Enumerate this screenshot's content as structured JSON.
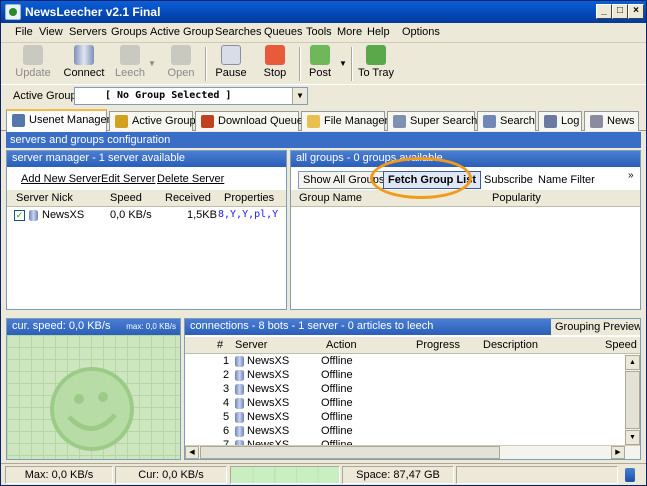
{
  "window": {
    "title": "NewsLeecher v2.1 Final"
  },
  "menu": [
    "File",
    "View",
    "Servers",
    "Groups",
    "Active Group",
    "Searches",
    "Queues",
    "Tools",
    "More",
    "Help",
    "Options"
  ],
  "toolbar": {
    "update": "Update",
    "connect": "Connect",
    "leech": "Leech",
    "open": "Open",
    "pause": "Pause",
    "stop": "Stop",
    "post": "Post",
    "to_tray": "To Tray"
  },
  "active_group": {
    "label": "Active Group",
    "value": "[ No Group Selected ]"
  },
  "tabs": [
    "Usenet Manager",
    "Active Group",
    "Download Queue",
    "File Manager",
    "Super Search",
    "Search",
    "Log",
    "News"
  ],
  "section_title": "servers and groups configuration",
  "server_manager": {
    "header": "server manager - 1 server available",
    "actions": [
      "Add New Server",
      "Edit Server",
      "Delete Server"
    ],
    "columns": [
      "Server Nick",
      "Speed",
      "Received",
      "Properties"
    ],
    "rows": [
      {
        "nick": "NewsXS",
        "speed": "0,0 KB/s",
        "received": "1,5KB",
        "properties": "8,Y,Y,pl,Y"
      }
    ]
  },
  "groups": {
    "header": "all groups - 0 groups available",
    "show_all": "Show All Groups",
    "fetch": "Fetch Group List",
    "subscribe": "Subscribe",
    "filter": "Name Filter",
    "more": "»",
    "columns": [
      "Group Name",
      "Popularity"
    ]
  },
  "speed": {
    "header": "cur. speed: 0,0 KB/s",
    "max": "max: 0,0 KB/s"
  },
  "connections": {
    "header": "connections - 8 bots - 1 server - 0 articles to leech",
    "grouping": "Grouping",
    "preview": "Preview",
    "columns": [
      "#",
      "Server",
      "Action",
      "Progress",
      "Description",
      "Speed"
    ],
    "rows": [
      {
        "n": "1",
        "server": "NewsXS",
        "action": "Offline"
      },
      {
        "n": "2",
        "server": "NewsXS",
        "action": "Offline"
      },
      {
        "n": "3",
        "server": "NewsXS",
        "action": "Offline"
      },
      {
        "n": "4",
        "server": "NewsXS",
        "action": "Offline"
      },
      {
        "n": "5",
        "server": "NewsXS",
        "action": "Offline"
      },
      {
        "n": "6",
        "server": "NewsXS",
        "action": "Offline"
      },
      {
        "n": "7",
        "server": "NewsXS",
        "action": "Offline"
      }
    ]
  },
  "status": {
    "max": "Max: 0,0 KB/s",
    "cur": "Cur: 0,0 KB/s",
    "space": "Space: 87,47 GB"
  },
  "colors": {
    "title_bar": "#0447b5",
    "panel_header": "#3a6ec6",
    "highlight": "#f29b1a",
    "chart_bg": "#cde6c0"
  }
}
